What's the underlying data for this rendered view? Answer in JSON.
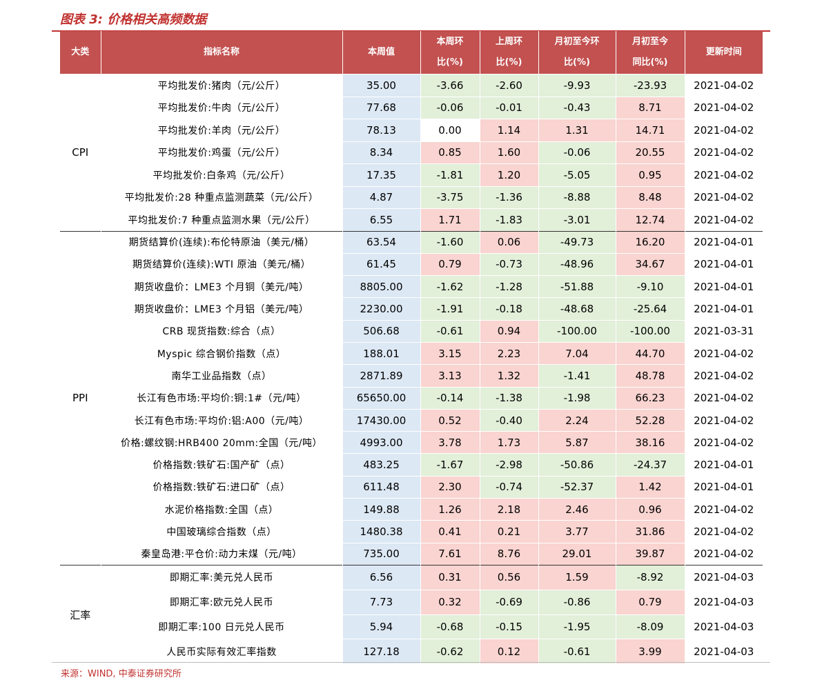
{
  "title": "图表 3: 价格相关高频数据",
  "source": "来源：WIND, 中泰证券研究所",
  "colors": {
    "header": "#c25150",
    "accent": "#c0312f",
    "blue": "#dce8f4",
    "green": "#e2efd9",
    "red": "#f9d4d0"
  },
  "headers": {
    "category": "大类",
    "name": "指标名称",
    "value": "本周值",
    "wow_1": "本周环",
    "wow_2": "比(%)",
    "lw_1": "上周环",
    "lw_2": "比(%)",
    "mtd_1": "月初至今环",
    "mtd_2": "比(%)",
    "yoy_1": "月初至今",
    "yoy_2": "同比(%)",
    "update": "更新时间"
  },
  "groups": [
    {
      "category": "CPI",
      "rows": [
        {
          "name": "平均批发价:猪肉（元/公斤）",
          "value": "35.00",
          "wow": "-3.66",
          "lw": "-2.60",
          "mtd": "-9.93",
          "yoy": "-23.93",
          "date": "2021-04-02",
          "c": [
            "green",
            "green",
            "green",
            "green"
          ]
        },
        {
          "name": "平均批发价:牛肉（元/公斤）",
          "value": "77.68",
          "wow": "-0.06",
          "lw": "-0.01",
          "mtd": "-0.43",
          "yoy": "8.71",
          "date": "2021-04-02",
          "c": [
            "green",
            "green",
            "green",
            "red"
          ]
        },
        {
          "name": "平均批发价:羊肉（元/公斤）",
          "value": "78.13",
          "wow": "0.00",
          "lw": "1.14",
          "mtd": "1.31",
          "yoy": "14.71",
          "date": "2021-04-02",
          "c": [
            "white",
            "red",
            "red",
            "red"
          ]
        },
        {
          "name": "平均批发价:鸡蛋（元/公斤）",
          "value": "8.34",
          "wow": "0.85",
          "lw": "1.60",
          "mtd": "-0.06",
          "yoy": "20.55",
          "date": "2021-04-02",
          "c": [
            "red",
            "red",
            "green",
            "red"
          ]
        },
        {
          "name": "平均批发价:白条鸡（元/公斤）",
          "value": "17.35",
          "wow": "-1.81",
          "lw": "1.20",
          "mtd": "-5.05",
          "yoy": "0.95",
          "date": "2021-04-02",
          "c": [
            "green",
            "red",
            "green",
            "red"
          ]
        },
        {
          "name": "平均批发价:28 种重点监测蔬菜（元/公斤）",
          "value": "4.87",
          "wow": "-3.75",
          "lw": "-1.36",
          "mtd": "-8.88",
          "yoy": "8.48",
          "date": "2021-04-02",
          "c": [
            "green",
            "green",
            "green",
            "red"
          ]
        },
        {
          "name": "平均批发价:7 种重点监测水果（元/公斤）",
          "value": "6.55",
          "wow": "1.71",
          "lw": "-1.83",
          "mtd": "-3.01",
          "yoy": "12.74",
          "date": "2021-04-02",
          "c": [
            "red",
            "green",
            "green",
            "red"
          ]
        }
      ]
    },
    {
      "category": "PPI",
      "rows": [
        {
          "name": "期货结算价(连续):布伦特原油（美元/桶）",
          "value": "63.54",
          "wow": "-1.60",
          "lw": "0.06",
          "mtd": "-49.73",
          "yoy": "16.20",
          "date": "2021-04-01",
          "c": [
            "green",
            "red",
            "green",
            "red"
          ]
        },
        {
          "name": "期货结算价(连续):WTI 原油（美元/桶）",
          "value": "61.45",
          "wow": "0.79",
          "lw": "-0.73",
          "mtd": "-48.96",
          "yoy": "34.67",
          "date": "2021-04-01",
          "c": [
            "red",
            "green",
            "green",
            "red"
          ]
        },
        {
          "name": "期货收盘价：LME3 个月铜（美元/吨）",
          "value": "8805.00",
          "wow": "-1.62",
          "lw": "-1.28",
          "mtd": "-51.88",
          "yoy": "-9.10",
          "date": "2021-04-01",
          "c": [
            "green",
            "green",
            "green",
            "green"
          ]
        },
        {
          "name": "期货收盘价：LME3 个月铝（美元/吨）",
          "value": "2230.00",
          "wow": "-1.91",
          "lw": "-0.18",
          "mtd": "-48.68",
          "yoy": "-25.64",
          "date": "2021-04-01",
          "c": [
            "green",
            "green",
            "green",
            "green"
          ]
        },
        {
          "name": "CRB 现货指数:综合（点）",
          "value": "506.68",
          "wow": "-0.61",
          "lw": "0.94",
          "mtd": "-100.00",
          "yoy": "-100.00",
          "date": "2021-03-31",
          "c": [
            "green",
            "red",
            "green",
            "green"
          ]
        },
        {
          "name": "Myspic 综合钢价指数（点）",
          "value": "188.01",
          "wow": "3.15",
          "lw": "2.23",
          "mtd": "7.04",
          "yoy": "44.70",
          "date": "2021-04-02",
          "c": [
            "red",
            "red",
            "red",
            "red"
          ]
        },
        {
          "name": "南华工业品指数（点）",
          "value": "2871.89",
          "wow": "3.13",
          "lw": "1.32",
          "mtd": "-1.41",
          "yoy": "48.78",
          "date": "2021-04-02",
          "c": [
            "red",
            "red",
            "green",
            "red"
          ]
        },
        {
          "name": "长江有色市场:平均价:铜:1#（元/吨）",
          "value": "65650.00",
          "wow": "-0.14",
          "lw": "-1.38",
          "mtd": "-1.98",
          "yoy": "66.23",
          "date": "2021-04-02",
          "c": [
            "green",
            "green",
            "green",
            "red"
          ]
        },
        {
          "name": "长江有色市场:平均价:铝:A00（元/吨）",
          "value": "17430.00",
          "wow": "0.52",
          "lw": "-0.40",
          "mtd": "2.24",
          "yoy": "52.28",
          "date": "2021-04-02",
          "c": [
            "red",
            "green",
            "red",
            "red"
          ]
        },
        {
          "name": "价格:螺纹钢:HRB400 20mm:全国（元/吨）",
          "value": "4993.00",
          "wow": "3.78",
          "lw": "1.73",
          "mtd": "5.87",
          "yoy": "38.16",
          "date": "2021-04-02",
          "c": [
            "red",
            "red",
            "red",
            "red"
          ]
        },
        {
          "name": "价格指数:铁矿石:国产矿（点）",
          "value": "483.25",
          "wow": "-1.67",
          "lw": "-2.98",
          "mtd": "-50.86",
          "yoy": "-24.37",
          "date": "2021-04-01",
          "c": [
            "green",
            "green",
            "green",
            "green"
          ]
        },
        {
          "name": "价格指数:铁矿石:进口矿（点）",
          "value": "611.48",
          "wow": "2.30",
          "lw": "-0.74",
          "mtd": "-52.37",
          "yoy": "1.42",
          "date": "2021-04-01",
          "c": [
            "red",
            "green",
            "green",
            "red"
          ]
        },
        {
          "name": "水泥价格指数:全国（点）",
          "value": "149.88",
          "wow": "1.26",
          "lw": "2.18",
          "mtd": "2.46",
          "yoy": "0.96",
          "date": "2021-04-02",
          "c": [
            "red",
            "red",
            "red",
            "red"
          ]
        },
        {
          "name": "中国玻璃综合指数（点）",
          "value": "1480.38",
          "wow": "0.41",
          "lw": "0.21",
          "mtd": "3.77",
          "yoy": "31.86",
          "date": "2021-04-02",
          "c": [
            "red",
            "red",
            "red",
            "red"
          ]
        },
        {
          "name": "秦皇岛港:平仓价:动力末煤（元/吨）",
          "value": "735.00",
          "wow": "7.61",
          "lw": "8.76",
          "mtd": "29.01",
          "yoy": "39.87",
          "date": "2021-04-02",
          "c": [
            "red",
            "red",
            "red",
            "red"
          ]
        }
      ]
    },
    {
      "category": "汇率",
      "rows": [
        {
          "name": "即期汇率:美元兑人民币",
          "value": "6.56",
          "wow": "0.31",
          "lw": "0.56",
          "mtd": "1.59",
          "yoy": "-8.92",
          "date": "2021-04-03",
          "c": [
            "red",
            "red",
            "red",
            "green"
          ]
        },
        {
          "name": "即期汇率:欧元兑人民币",
          "value": "7.73",
          "wow": "0.32",
          "lw": "-0.69",
          "mtd": "-0.86",
          "yoy": "0.79",
          "date": "2021-04-03",
          "c": [
            "red",
            "green",
            "green",
            "red"
          ]
        },
        {
          "name": "即期汇率:100 日元兑人民币",
          "value": "5.94",
          "wow": "-0.68",
          "lw": "-0.15",
          "mtd": "-1.95",
          "yoy": "-8.09",
          "date": "2021-04-03",
          "c": [
            "green",
            "green",
            "green",
            "green"
          ]
        },
        {
          "name": "人民币实际有效汇率指数",
          "value": "127.18",
          "wow": "-0.62",
          "lw": "0.12",
          "mtd": "-0.61",
          "yoy": "3.99",
          "date": "2021-04-03",
          "c": [
            "green",
            "red",
            "green",
            "red"
          ]
        }
      ]
    }
  ]
}
